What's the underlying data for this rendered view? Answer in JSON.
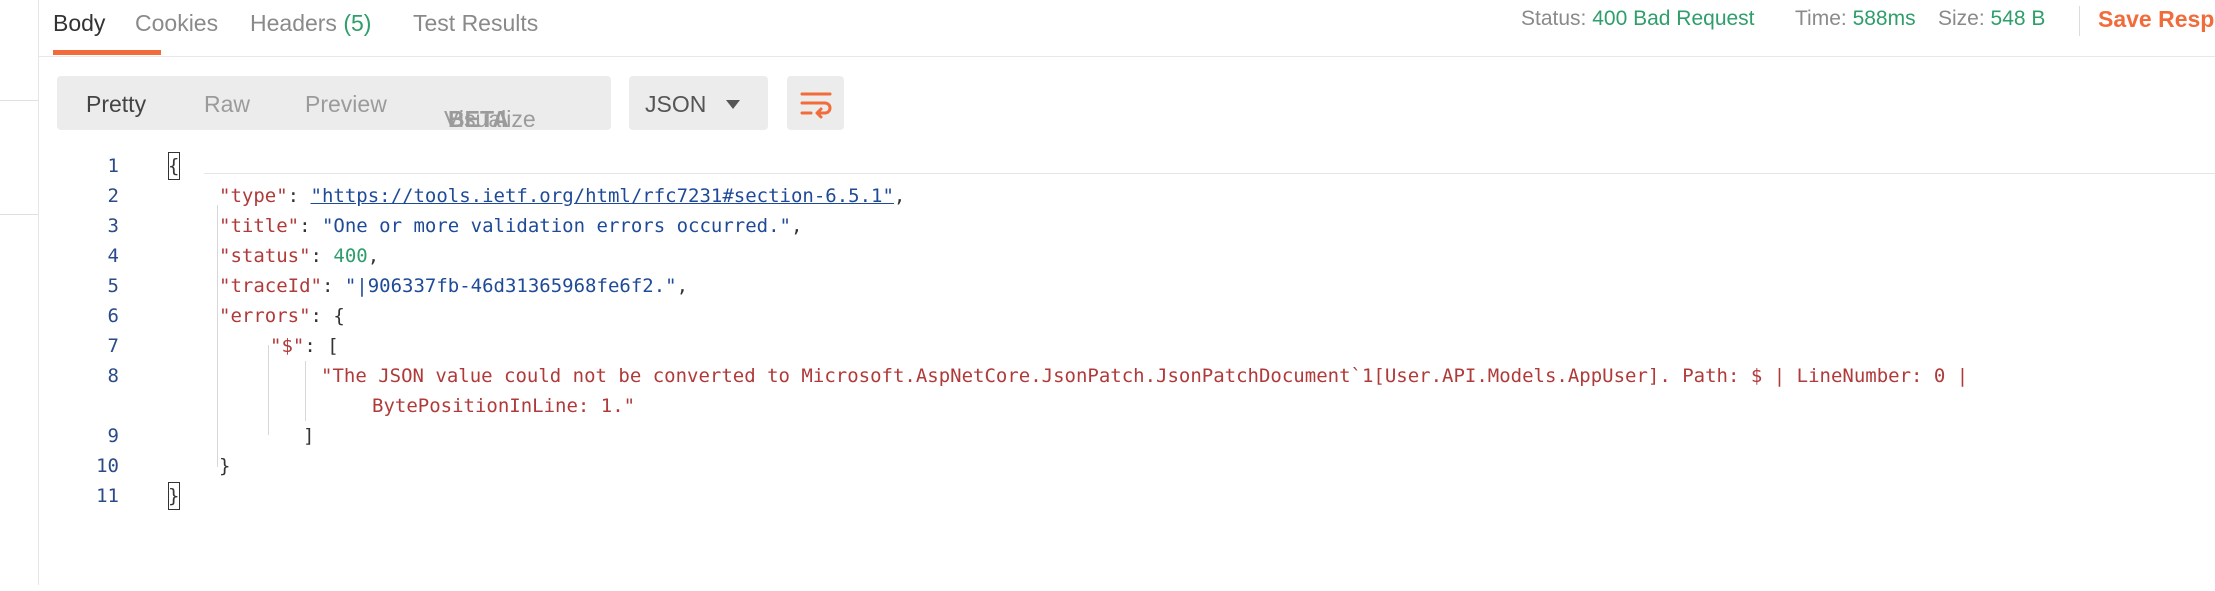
{
  "tabs": [
    {
      "label": "Body",
      "active": true
    },
    {
      "label": "Cookies"
    },
    {
      "label": "Headers",
      "count": "(5)"
    },
    {
      "label": "Test Results"
    }
  ],
  "response_meta": {
    "status_label": "Status:",
    "status_value": "400 Bad Request",
    "time_label": "Time:",
    "time_value": "588ms",
    "size_label": "Size:",
    "size_value": "548 B",
    "save_label": "Save Resp"
  },
  "view_modes": {
    "pretty": "Pretty",
    "raw": "Raw",
    "preview": "Preview",
    "visualize": "Visualize",
    "beta": "BETA"
  },
  "format_select": {
    "value": "JSON",
    "icon": "chevron-down-icon"
  },
  "wrap_button": {
    "icon": "wrap-lines-icon"
  },
  "code_lines": [
    {
      "num": "1",
      "text": "{"
    },
    {
      "num": "2",
      "key": "\"type\"",
      "sep": ": ",
      "value": "\"https://tools.ietf.org/html/rfc7231#section-6.5.1\"",
      "tail": ","
    },
    {
      "num": "3",
      "key": "\"title\"",
      "sep": ": ",
      "value": "\"One or more validation errors occurred.\"",
      "tail": ","
    },
    {
      "num": "4",
      "key": "\"status\"",
      "sep": ": ",
      "value": "400",
      "tail": ","
    },
    {
      "num": "5",
      "key": "\"traceId\"",
      "sep": ": ",
      "value": "\"|906337fb-46d31365968fe6f2.\"",
      "tail": ","
    },
    {
      "num": "6",
      "key": "\"errors\"",
      "sep": ": ",
      "value": "{"
    },
    {
      "num": "7",
      "key": "\"$\"",
      "sep": ": ",
      "value": "["
    },
    {
      "num": "8",
      "value": "\"The JSON value could not be converted to Microsoft.AspNetCore.JsonPatch.JsonPatchDocument`1[User.API.Models.AppUser]. Path: $ | LineNumber: 0 |",
      "continuation": "BytePositionInLine: 1.\""
    },
    {
      "num": "9",
      "text": "]"
    },
    {
      "num": "10",
      "text": "}"
    },
    {
      "num": "11",
      "text": "}"
    }
  ],
  "colors": {
    "accent": "#f26b3a",
    "status_green": "#2e9e6b",
    "json_key": "#b03a3a",
    "json_string": "#1f4a98",
    "beta_blue": "#3d8be8"
  }
}
